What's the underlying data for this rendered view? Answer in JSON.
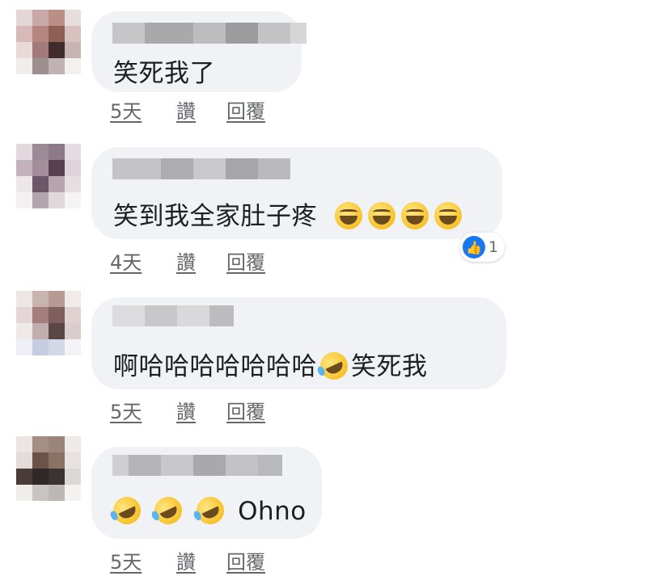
{
  "comments": [
    {
      "text": "笑死我了",
      "emojis": [],
      "time": "5天",
      "like": "讚",
      "reply": "回覆"
    },
    {
      "text": "笑到我全家肚子疼",
      "emojis": [
        "grin",
        "grin",
        "grin",
        "grin"
      ],
      "time": "4天",
      "like": "讚",
      "reply": "回覆",
      "reaction_count": "1"
    },
    {
      "text": "啊哈哈哈哈哈哈哈",
      "text_after": "笑死我",
      "emojis": [
        "rofl"
      ],
      "time": "5天",
      "like": "讚",
      "reply": "回覆"
    },
    {
      "text": "Ohno",
      "emojis": [
        "rofl",
        "rofl",
        "rofl"
      ],
      "time": "5天",
      "like": "讚",
      "reply": "回覆"
    }
  ],
  "colors": {
    "bubble": "#f0f2f5",
    "text": "#1c1e21",
    "meta": "#65676b",
    "like_blue": "#1877f2"
  }
}
